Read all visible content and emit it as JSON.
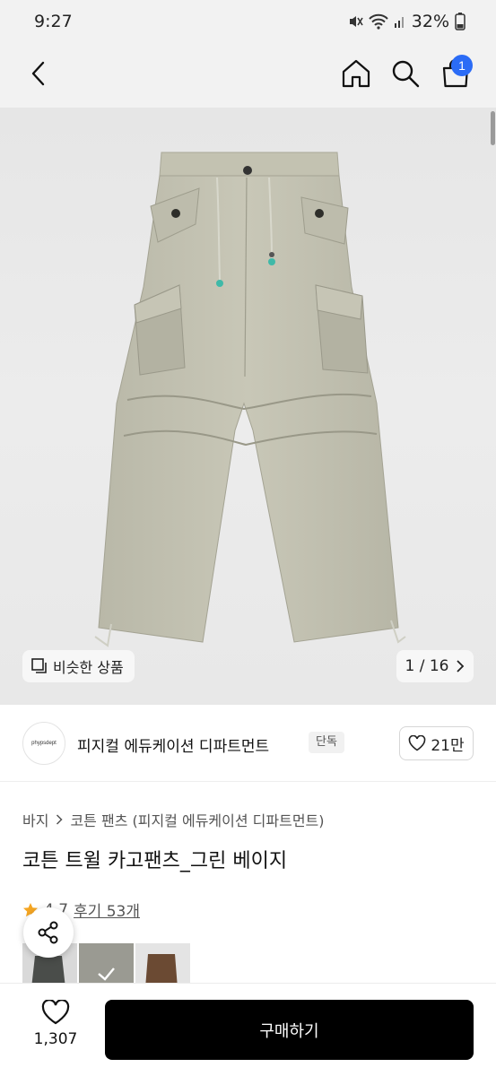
{
  "status_bar": {
    "time": "9:27",
    "battery": "32%",
    "icons": [
      "mute-icon",
      "wifi-icon",
      "signal-icon",
      "battery-icon"
    ]
  },
  "header": {
    "icons": [
      "back-icon",
      "home-icon",
      "search-icon",
      "cart-icon"
    ],
    "cart_badge": "1",
    "accent_color": "#2b6cf6"
  },
  "gallery": {
    "similar_label": "비슷한 상품",
    "page_counter": "1 / 16"
  },
  "brand": {
    "logo_text": "phypsdept",
    "name": "피지컬 에듀케이션 디파트먼트",
    "exclusive_badge": "단독",
    "like_count": "21만"
  },
  "product": {
    "breadcrumb": [
      "바지",
      "코튼 팬츠 (피지컬 에듀케이션 디파트먼트)"
    ],
    "title": "코튼 트윌 카고팬츠_그린 베이지",
    "rating": "4.7",
    "review_label": "후기 53개",
    "color_options": [
      "charcoal",
      "green beige",
      "brown"
    ]
  },
  "bottom_bar": {
    "wish_count": "1,307",
    "buy_label": "구매하기"
  }
}
